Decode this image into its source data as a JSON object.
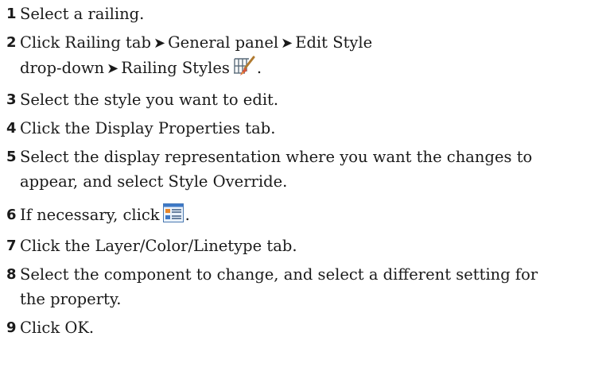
{
  "steps": [
    {
      "num": "1",
      "text": "Select a railing."
    },
    {
      "num": "2",
      "line1": {
        "a": "Click Railing tab",
        "b": "General panel",
        "c": "Edit Style"
      },
      "line2": {
        "a": "drop-down",
        "b": "Railing Styles",
        "icon": "railing-styles-icon",
        "end": "."
      }
    },
    {
      "num": "3",
      "text": "Select the style you want to edit."
    },
    {
      "num": "4",
      "text": "Click the Display Properties tab."
    },
    {
      "num": "5",
      "line1": "Select the display representation where you want the changes to",
      "line2": "appear, and select Style Override."
    },
    {
      "num": "6",
      "text": "If necessary, click",
      "icon": "edit-display-properties-icon",
      "end": "."
    },
    {
      "num": "7",
      "text": "Click the Layer/Color/Linetype tab."
    },
    {
      "num": "8",
      "line1": "Select the component to change, and select a different setting for",
      "line2": "the property."
    },
    {
      "num": "9",
      "text": "Click OK."
    }
  ],
  "arrow_glyph": "➤"
}
